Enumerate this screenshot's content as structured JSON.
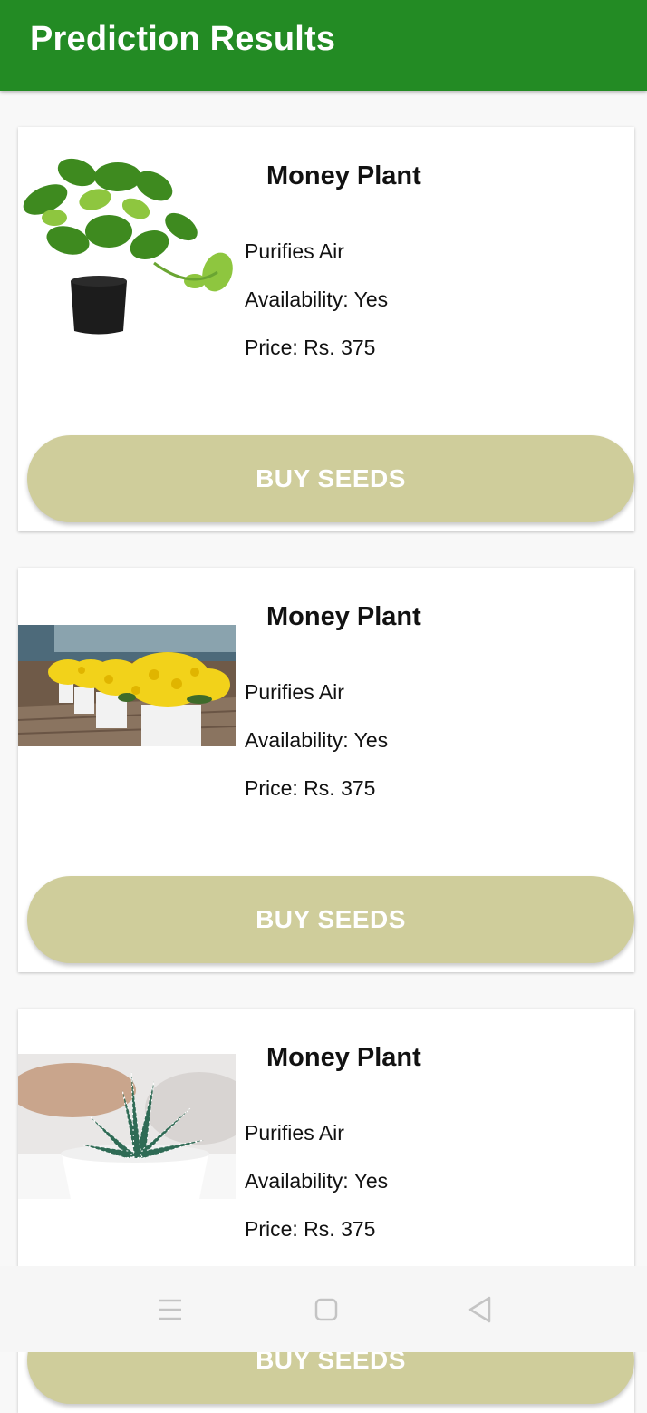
{
  "header": {
    "title": "Prediction Results"
  },
  "cards": [
    {
      "name": "Money Plant",
      "benefit": "Purifies Air",
      "availability": "Availability: Yes",
      "price": "Price: Rs. 375",
      "button": "BUY SEEDS",
      "image": "money-plant-pot"
    },
    {
      "name": "Money Plant",
      "benefit": "Purifies Air",
      "availability": "Availability: Yes",
      "price": "Price: Rs. 375",
      "button": "BUY SEEDS",
      "image": "yellow-chrysanthemums"
    },
    {
      "name": "Money Plant",
      "benefit": "Purifies Air",
      "availability": "Availability: Yes",
      "price": "Price: Rs. 375",
      "button": "BUY SEEDS",
      "image": "haworthia-succulent"
    }
  ],
  "navbar": {
    "icons": [
      "menu-icon",
      "home-icon",
      "back-icon"
    ]
  },
  "colors": {
    "appbar": "#238b24",
    "button": "#cfcd9b",
    "background": "#f8f8f8"
  }
}
